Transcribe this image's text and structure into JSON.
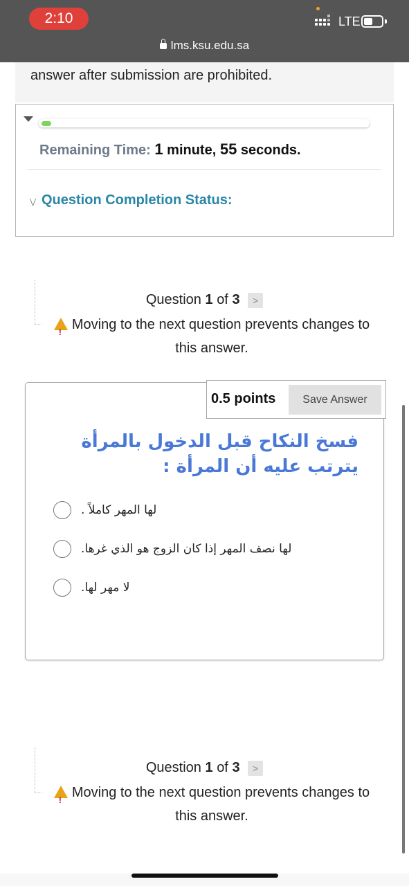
{
  "status_bar": {
    "time": "2:10",
    "network": "LTE"
  },
  "browser": {
    "url": "lms.ksu.edu.sa"
  },
  "instructions_tail": "answer after submission are prohibited.",
  "timer": {
    "label": "Remaining Time:",
    "minutes": "1",
    "minutes_unit": "minute,",
    "seconds": "55",
    "seconds_unit": "seconds.",
    "progress_fraction": 0.03
  },
  "completion_status_label": "Question Completion Status:",
  "question_nav": {
    "prefix": "Question",
    "current": "1",
    "of": "of",
    "total": "3",
    "next_symbol": ">",
    "warning_line1": "Moving to the next question prevents changes to",
    "warning_line2": "this answer."
  },
  "question": {
    "points": "0.5 points",
    "save_label": "Save Answer",
    "text": "فسخ النكاح قبل الدخول بالمرأة يترتب عليه أن المرأة :",
    "options": [
      {
        "label": "لها المهر كاملاً ."
      },
      {
        "label": "لها نصف المهر إذا كان الزوج هو الذي غرها."
      },
      {
        "label": "لا مهر لها."
      }
    ]
  },
  "colors": {
    "status_bar_bg": "#555555",
    "time_pill": "#e0403a",
    "link_teal": "#2a86a6",
    "question_text": "#4a78d6",
    "progress_green": "#7dd35b",
    "warning_yellow": "#e8a317"
  },
  "icons": [
    "lock-icon",
    "signal-icon",
    "battery-icon",
    "caret-down-icon",
    "double-chevron-icon",
    "warning-icon",
    "chevron-right-icon"
  ]
}
